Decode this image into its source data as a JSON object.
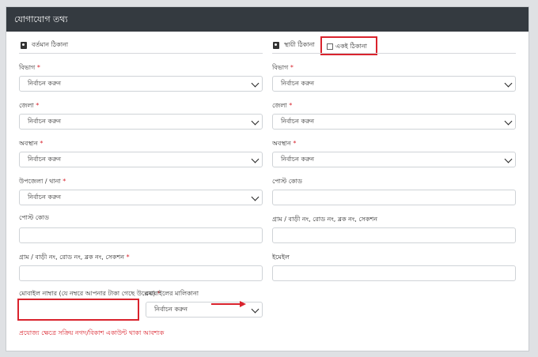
{
  "header": {
    "title": "যোগাযোগ তথ্য"
  },
  "present": {
    "title": "বর্তমান ঠিকানা",
    "division_label": "বিভাগ",
    "district_label": "জেলা",
    "location_label": "অবস্থান",
    "upazila_label": "উপজেলা / থানা",
    "postcode_label": "পোস্ট কোড",
    "address_label": "গ্রাম / বাড়ী নং, রোড নং, ব্লক নং, সেকশন",
    "mobile_label": "মোবাইল নাম্বার (যে নম্বরে আপনার টাকা গেছে উল্লেখ)",
    "ownership_label": "মোবাইলের মালিকানা"
  },
  "permanent": {
    "title": "স্থায়ী ঠিকানা",
    "same_label": "একই ঠিকানা",
    "division_label": "বিভাগ",
    "district_label": "জেলা",
    "location_label": "অবস্থান",
    "postcode_label": "পোস্ট কোড",
    "address_label": "গ্রাম / বাড়ী নং, রোড নং, ব্লক নং, সেকশন",
    "email_label": "ইমেইল"
  },
  "select_placeholder": "নির্বাচন করুন",
  "required_mark": "*",
  "note": "প্রযোজ্য ক্ষেত্রে সক্রিয় নগদ/বিকাশ একাউন্ট থাকা আবশ্যক",
  "colors": {
    "header_bg": "#343a40",
    "required": "#d9232d",
    "highlight": "#d9232d"
  }
}
